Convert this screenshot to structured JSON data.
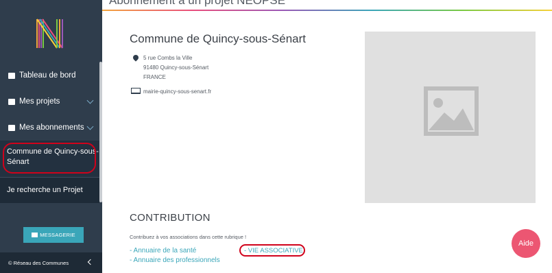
{
  "header": {
    "title": "Abonnement à un projet NEOPSE"
  },
  "sidebar": {
    "items": [
      {
        "label": "Tableau de bord",
        "icon": "dashboard-icon"
      },
      {
        "label": "Mes projets",
        "icon": "folder-icon"
      },
      {
        "label": "Mes abonnements",
        "icon": "subscriptions-icon"
      }
    ],
    "active_sub": "Commune de Quincy-sous-Sénart",
    "search_project": "Je recherche un Projet",
    "messagerie": "MESSAGERIE",
    "footer": "© Réseau des Communes"
  },
  "commune": {
    "name": "Commune de Quincy-sous-Sénart",
    "address_line1": "5 rue Combs la Ville",
    "address_line2": "91480 Quincy-sous-Sénart",
    "country": "FRANCE",
    "website": "mairie-quincy-sous-senart.fr"
  },
  "contribution": {
    "title": "CONTRIBUTION",
    "intro": "Contribuez à vos associations dans cette rubrique !",
    "links": [
      "- Annuaire de la santé",
      "- Annuaire des professionnels",
      "- VIE ASSOCIATIVE"
    ]
  },
  "help_button": "Aide",
  "colors": {
    "sidebar": "#2f3d4c",
    "accent": "#3aa6b9",
    "help": "#ec5672",
    "annotation": "#d0021b"
  }
}
